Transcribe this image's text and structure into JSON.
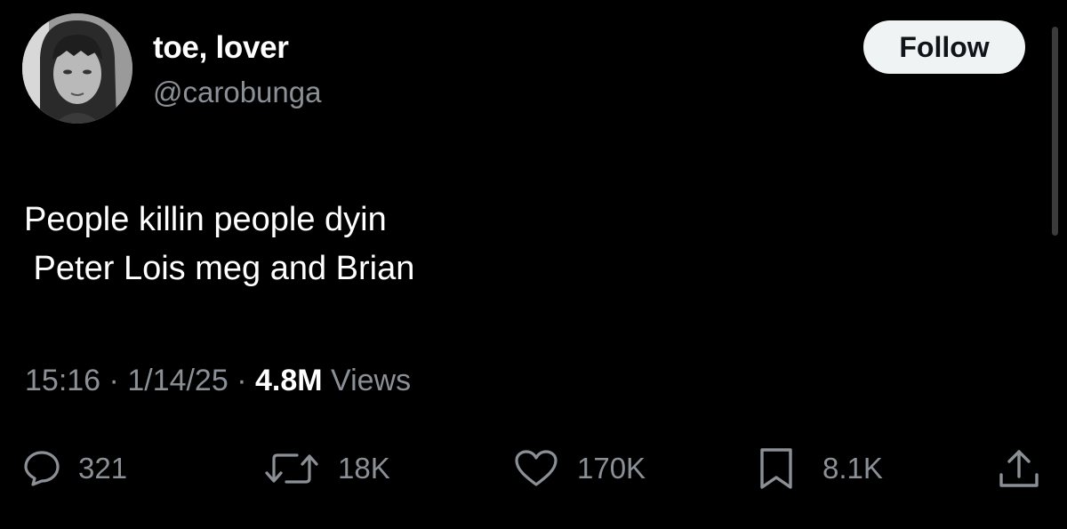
{
  "author": {
    "display_name": "toe, lover",
    "handle": "@carobunga"
  },
  "follow_label": "Follow",
  "tweet": {
    "lines": [
      "People killin people dyin",
      " Peter Lois meg and Brian"
    ]
  },
  "meta": {
    "time": "15:16",
    "date": "1/14/25",
    "separator": " · ",
    "views_count": "4.8M",
    "views_label": " Views"
  },
  "actions": {
    "replies": "321",
    "reposts": "18K",
    "likes": "170K",
    "bookmarks": "8.1K"
  },
  "icons": {
    "reply": "reply-bubble-icon",
    "repost": "repost-arrows-icon",
    "like": "heart-icon",
    "bookmark": "bookmark-icon",
    "share": "share-upload-icon"
  },
  "colors": {
    "background": "#000000",
    "text": "#ffffff",
    "muted": "#8b9096",
    "button_bg": "#eff3f4"
  }
}
